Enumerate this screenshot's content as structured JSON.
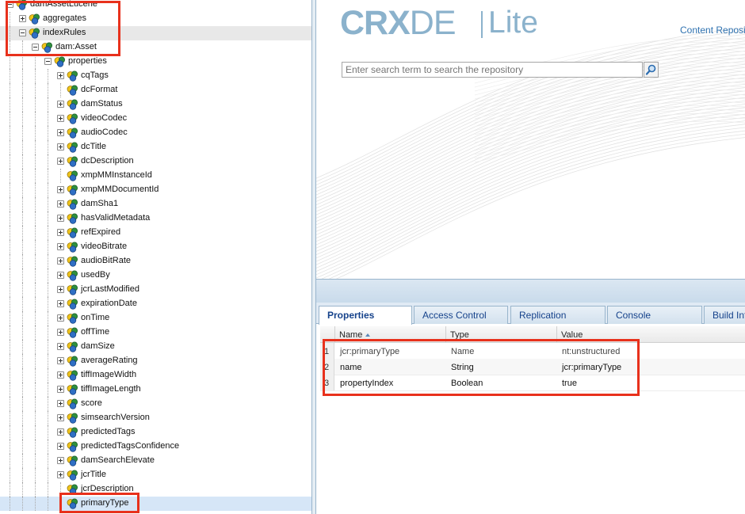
{
  "tree": {
    "rows": [
      {
        "label": "damAssetLucene",
        "depth": 0,
        "toggle": "minus"
      },
      {
        "label": "aggregates",
        "depth": 1,
        "toggle": "plus"
      },
      {
        "label": "indexRules",
        "depth": 1,
        "toggle": "minus"
      },
      {
        "label": "dam:Asset",
        "depth": 2,
        "toggle": "minus"
      },
      {
        "label": "properties",
        "depth": 3,
        "toggle": "minus"
      },
      {
        "label": "cqTags",
        "depth": 4,
        "toggle": "plus"
      },
      {
        "label": "dcFormat",
        "depth": 4,
        "toggle": "none"
      },
      {
        "label": "damStatus",
        "depth": 4,
        "toggle": "plus"
      },
      {
        "label": "videoCodec",
        "depth": 4,
        "toggle": "plus"
      },
      {
        "label": "audioCodec",
        "depth": 4,
        "toggle": "plus"
      },
      {
        "label": "dcTitle",
        "depth": 4,
        "toggle": "plus"
      },
      {
        "label": "dcDescription",
        "depth": 4,
        "toggle": "plus"
      },
      {
        "label": "xmpMMInstanceId",
        "depth": 4,
        "toggle": "none"
      },
      {
        "label": "xmpMMDocumentId",
        "depth": 4,
        "toggle": "plus"
      },
      {
        "label": "damSha1",
        "depth": 4,
        "toggle": "plus"
      },
      {
        "label": "hasValidMetadata",
        "depth": 4,
        "toggle": "plus"
      },
      {
        "label": "refExpired",
        "depth": 4,
        "toggle": "plus"
      },
      {
        "label": "videoBitrate",
        "depth": 4,
        "toggle": "plus"
      },
      {
        "label": "audioBitRate",
        "depth": 4,
        "toggle": "plus"
      },
      {
        "label": "usedBy",
        "depth": 4,
        "toggle": "plus"
      },
      {
        "label": "jcrLastModified",
        "depth": 4,
        "toggle": "plus"
      },
      {
        "label": "expirationDate",
        "depth": 4,
        "toggle": "plus"
      },
      {
        "label": "onTime",
        "depth": 4,
        "toggle": "plus"
      },
      {
        "label": "offTime",
        "depth": 4,
        "toggle": "plus"
      },
      {
        "label": "damSize",
        "depth": 4,
        "toggle": "plus"
      },
      {
        "label": "averageRating",
        "depth": 4,
        "toggle": "plus"
      },
      {
        "label": "tiffImageWidth",
        "depth": 4,
        "toggle": "plus"
      },
      {
        "label": "tiffImageLength",
        "depth": 4,
        "toggle": "plus"
      },
      {
        "label": "score",
        "depth": 4,
        "toggle": "plus"
      },
      {
        "label": "simsearchVersion",
        "depth": 4,
        "toggle": "plus"
      },
      {
        "label": "predictedTags",
        "depth": 4,
        "toggle": "plus"
      },
      {
        "label": "predictedTagsConfidence",
        "depth": 4,
        "toggle": "plus"
      },
      {
        "label": "damSearchElevate",
        "depth": 4,
        "toggle": "plus"
      },
      {
        "label": "jcrTitle",
        "depth": 4,
        "toggle": "plus"
      },
      {
        "label": "jcrDescription",
        "depth": 4,
        "toggle": "none"
      },
      {
        "label": "primaryType",
        "depth": 4,
        "toggle": "none",
        "selected": true
      }
    ]
  },
  "header": {
    "logo_main": "CRX",
    "logo_de": "DE",
    "logo_lite": "Lite",
    "link": "Content Reposi",
    "search_placeholder": "Enter search term to search the repository"
  },
  "tabs": [
    "Properties",
    "Access Control",
    "Replication",
    "Console",
    "Build Inf"
  ],
  "grid": {
    "columns": [
      "Name",
      "Type",
      "Value"
    ],
    "rows": [
      {
        "n": "1",
        "name": "jcr:primaryType",
        "type": "Name",
        "value": "nt:unstructured"
      },
      {
        "n": "2",
        "name": "name",
        "type": "String",
        "value": "jcr:primaryType"
      },
      {
        "n": "3",
        "name": "propertyIndex",
        "type": "Boolean",
        "value": "true"
      }
    ]
  },
  "colors": {
    "highlight_box": "#e8311c",
    "logo": "#8bb2cc",
    "tab_text": "#15428b",
    "selected_row": "#d6e6f7"
  }
}
